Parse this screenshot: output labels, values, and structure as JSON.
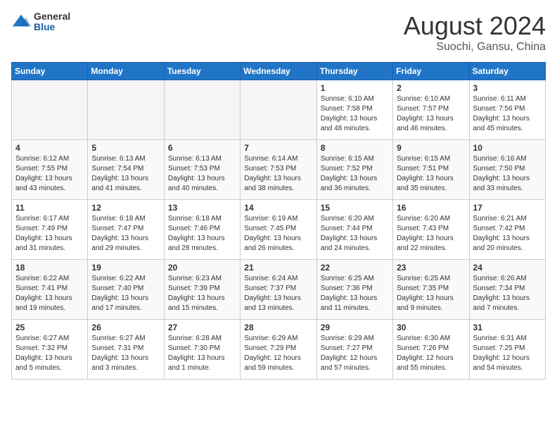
{
  "logo": {
    "general": "General",
    "blue": "Blue"
  },
  "title": {
    "month_year": "August 2024",
    "location": "Suochi, Gansu, China"
  },
  "headers": [
    "Sunday",
    "Monday",
    "Tuesday",
    "Wednesday",
    "Thursday",
    "Friday",
    "Saturday"
  ],
  "weeks": [
    [
      {
        "day": "",
        "empty": true
      },
      {
        "day": "",
        "empty": true
      },
      {
        "day": "",
        "empty": true
      },
      {
        "day": "",
        "empty": true
      },
      {
        "day": "1",
        "sunrise": "6:10 AM",
        "sunset": "7:58 PM",
        "daylight": "13 hours and 48 minutes."
      },
      {
        "day": "2",
        "sunrise": "6:10 AM",
        "sunset": "7:57 PM",
        "daylight": "13 hours and 46 minutes."
      },
      {
        "day": "3",
        "sunrise": "6:11 AM",
        "sunset": "7:56 PM",
        "daylight": "13 hours and 45 minutes."
      }
    ],
    [
      {
        "day": "4",
        "sunrise": "6:12 AM",
        "sunset": "7:55 PM",
        "daylight": "13 hours and 43 minutes."
      },
      {
        "day": "5",
        "sunrise": "6:13 AM",
        "sunset": "7:54 PM",
        "daylight": "13 hours and 41 minutes."
      },
      {
        "day": "6",
        "sunrise": "6:13 AM",
        "sunset": "7:53 PM",
        "daylight": "13 hours and 40 minutes."
      },
      {
        "day": "7",
        "sunrise": "6:14 AM",
        "sunset": "7:53 PM",
        "daylight": "13 hours and 38 minutes."
      },
      {
        "day": "8",
        "sunrise": "6:15 AM",
        "sunset": "7:52 PM",
        "daylight": "13 hours and 36 minutes."
      },
      {
        "day": "9",
        "sunrise": "6:15 AM",
        "sunset": "7:51 PM",
        "daylight": "13 hours and 35 minutes."
      },
      {
        "day": "10",
        "sunrise": "6:16 AM",
        "sunset": "7:50 PM",
        "daylight": "13 hours and 33 minutes."
      }
    ],
    [
      {
        "day": "11",
        "sunrise": "6:17 AM",
        "sunset": "7:49 PM",
        "daylight": "13 hours and 31 minutes."
      },
      {
        "day": "12",
        "sunrise": "6:18 AM",
        "sunset": "7:47 PM",
        "daylight": "13 hours and 29 minutes."
      },
      {
        "day": "13",
        "sunrise": "6:18 AM",
        "sunset": "7:46 PM",
        "daylight": "13 hours and 28 minutes."
      },
      {
        "day": "14",
        "sunrise": "6:19 AM",
        "sunset": "7:45 PM",
        "daylight": "13 hours and 26 minutes."
      },
      {
        "day": "15",
        "sunrise": "6:20 AM",
        "sunset": "7:44 PM",
        "daylight": "13 hours and 24 minutes."
      },
      {
        "day": "16",
        "sunrise": "6:20 AM",
        "sunset": "7:43 PM",
        "daylight": "13 hours and 22 minutes."
      },
      {
        "day": "17",
        "sunrise": "6:21 AM",
        "sunset": "7:42 PM",
        "daylight": "13 hours and 20 minutes."
      }
    ],
    [
      {
        "day": "18",
        "sunrise": "6:22 AM",
        "sunset": "7:41 PM",
        "daylight": "13 hours and 19 minutes."
      },
      {
        "day": "19",
        "sunrise": "6:22 AM",
        "sunset": "7:40 PM",
        "daylight": "13 hours and 17 minutes."
      },
      {
        "day": "20",
        "sunrise": "6:23 AM",
        "sunset": "7:39 PM",
        "daylight": "13 hours and 15 minutes."
      },
      {
        "day": "21",
        "sunrise": "6:24 AM",
        "sunset": "7:37 PM",
        "daylight": "13 hours and 13 minutes."
      },
      {
        "day": "22",
        "sunrise": "6:25 AM",
        "sunset": "7:36 PM",
        "daylight": "13 hours and 11 minutes."
      },
      {
        "day": "23",
        "sunrise": "6:25 AM",
        "sunset": "7:35 PM",
        "daylight": "13 hours and 9 minutes."
      },
      {
        "day": "24",
        "sunrise": "6:26 AM",
        "sunset": "7:34 PM",
        "daylight": "13 hours and 7 minutes."
      }
    ],
    [
      {
        "day": "25",
        "sunrise": "6:27 AM",
        "sunset": "7:32 PM",
        "daylight": "13 hours and 5 minutes."
      },
      {
        "day": "26",
        "sunrise": "6:27 AM",
        "sunset": "7:31 PM",
        "daylight": "13 hours and 3 minutes."
      },
      {
        "day": "27",
        "sunrise": "6:28 AM",
        "sunset": "7:30 PM",
        "daylight": "13 hours and 1 minute."
      },
      {
        "day": "28",
        "sunrise": "6:29 AM",
        "sunset": "7:29 PM",
        "daylight": "12 hours and 59 minutes."
      },
      {
        "day": "29",
        "sunrise": "6:29 AM",
        "sunset": "7:27 PM",
        "daylight": "12 hours and 57 minutes."
      },
      {
        "day": "30",
        "sunrise": "6:30 AM",
        "sunset": "7:26 PM",
        "daylight": "12 hours and 55 minutes."
      },
      {
        "day": "31",
        "sunrise": "6:31 AM",
        "sunset": "7:25 PM",
        "daylight": "12 hours and 54 minutes."
      }
    ]
  ],
  "labels": {
    "sunrise": "Sunrise:",
    "sunset": "Sunset:",
    "daylight": "Daylight:"
  }
}
